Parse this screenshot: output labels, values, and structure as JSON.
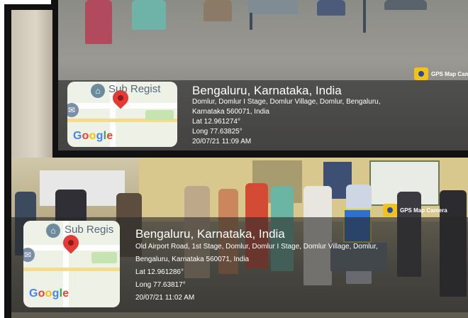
{
  "top_card": {
    "map_label": "Sub Regist",
    "map_logo": "Google",
    "place": "Bengaluru, Karnataka, India",
    "address_1": "Domlur, Domlur I Stage, Domlur Village, Domlur, Bengaluru,",
    "address_2": "Karnataka 560071, India",
    "lat": "Lat 12.961274°",
    "long": "Long 77.63825°",
    "datetime": "20/07/21 11:09 AM",
    "badge": "GPS Map Camera"
  },
  "bottom_card": {
    "map_label": "Sub Regis",
    "map_logo": "Google",
    "place": "Bengaluru, Karnataka, India",
    "address_1": "Old Airport Road, 1st Stage, Domlur, Domlur I Stage, Domlur Village, Domlur,",
    "address_2": "Bengaluru, Karnataka 560071, India",
    "lat": "Lat 12.961286°",
    "long": "Long 77.63817°",
    "datetime": "20/07/21 11:02 AM",
    "badge": "GPS Map Camera"
  },
  "colors": {
    "overlay": "#282828",
    "pin": "#e53935",
    "badge": "#f2c21b"
  }
}
